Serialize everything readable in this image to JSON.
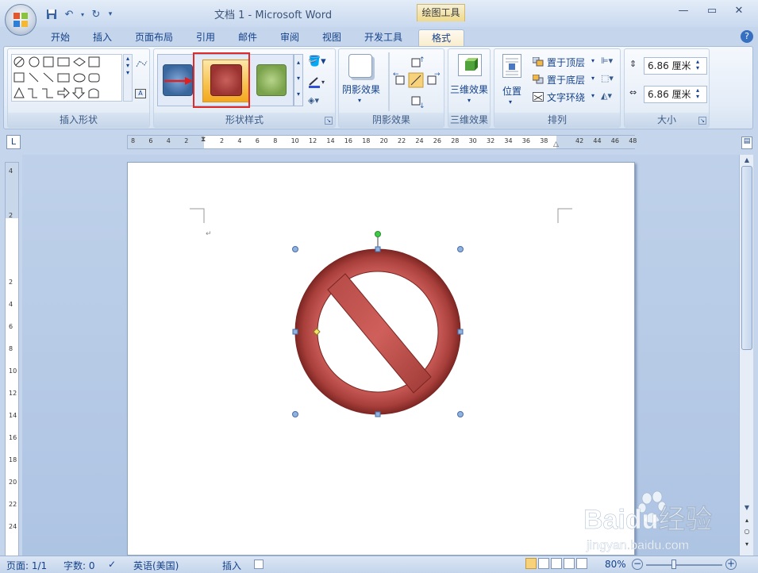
{
  "title": "文档 1 - Microsoft Word",
  "context_tab": "绘图工具",
  "tabs": [
    "开始",
    "插入",
    "页面布局",
    "引用",
    "邮件",
    "审阅",
    "视图",
    "开发工具",
    "格式"
  ],
  "active_tab": "格式",
  "groups": {
    "insert_shapes": "插入形状",
    "shape_styles": "形状样式",
    "shadow_effects": "阴影效果",
    "three_d": "三维效果",
    "arrange": "排列",
    "size": "大小"
  },
  "buttons": {
    "shadow_effect": "阴影效果",
    "three_d_effect": "三维效果",
    "position": "位置",
    "bring_front": "置于顶层",
    "send_back": "置于底层",
    "text_wrap": "文字环绕"
  },
  "size": {
    "height": "6.86 厘米",
    "width": "6.86 厘米"
  },
  "hruler_ticks": [
    "8",
    "6",
    "4",
    "2",
    "",
    "2",
    "4",
    "6",
    "8",
    "10",
    "12",
    "14",
    "16",
    "18",
    "20",
    "22",
    "24",
    "26",
    "28",
    "30",
    "32",
    "34",
    "36",
    "38",
    "",
    "42",
    "44",
    "46",
    "48"
  ],
  "vruler_ticks": [
    "4",
    "",
    "2",
    "",
    "",
    "2",
    "4",
    "6",
    "8",
    "10",
    "12",
    "14",
    "16",
    "18",
    "20",
    "22",
    "24"
  ],
  "status": {
    "page": "页面: 1/1",
    "words": "字数: 0",
    "language": "英语(美国)",
    "mode": "插入",
    "zoom": "80%"
  },
  "colors": {
    "shape_fill": "#b44a46",
    "shape_dark": "#8c2f2c",
    "selection_box": "#e12b2b",
    "style_blue": "#3b679f",
    "style_red": "#9b3431",
    "style_green": "#7aa24b"
  },
  "watermark": {
    "brand": "Baidu经验",
    "url": "jingyan.baidu.com"
  }
}
